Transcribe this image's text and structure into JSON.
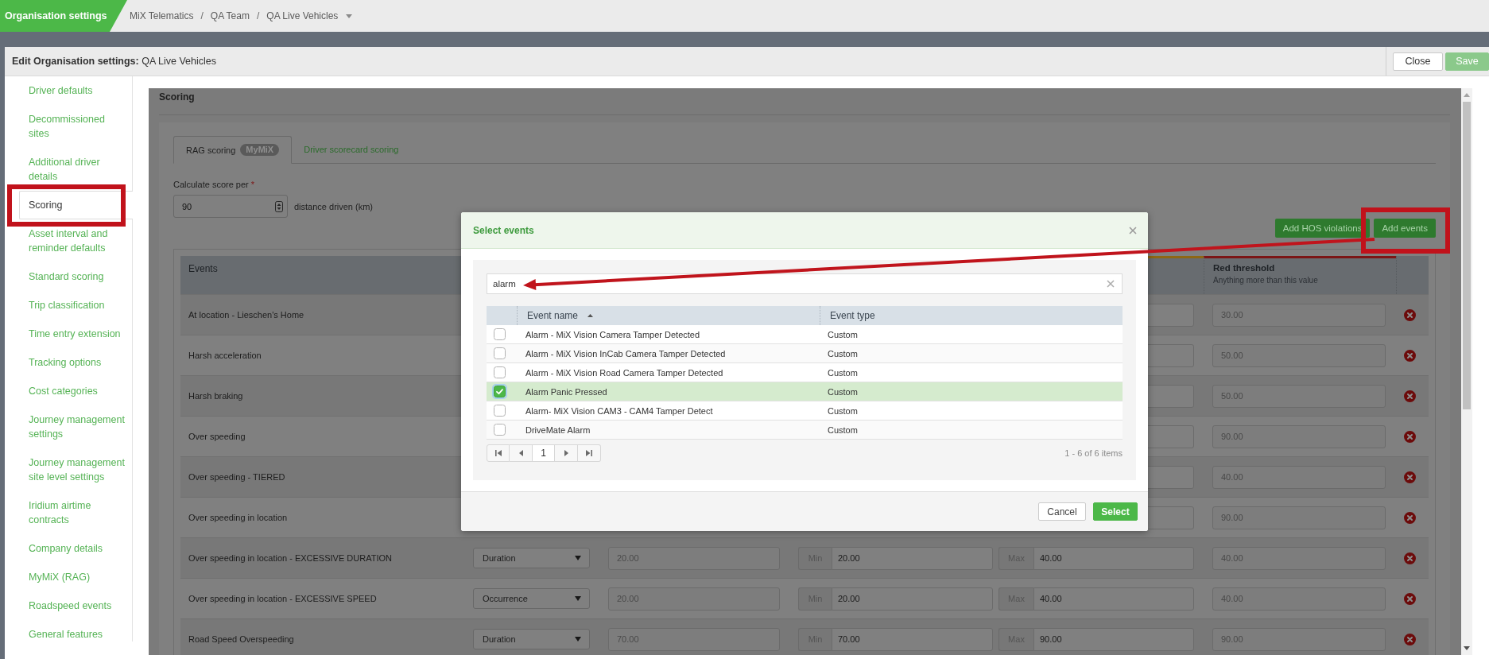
{
  "top_bar": {
    "title": "Organisation settings",
    "separator": "/",
    "breadcrumb": [
      {
        "label": "MiX Telematics",
        "dropdown": false
      },
      {
        "label": "QA Team",
        "dropdown": false
      },
      {
        "label": "QA Live Vehicles",
        "dropdown": true
      }
    ]
  },
  "panel": {
    "title": "**Edit Organisation settings:** QA Live Vehicles",
    "buttons": [
      {
        "label": "Close",
        "kind": "default",
        "disabled": false
      },
      {
        "label": "Save",
        "kind": "primary",
        "disabled": true
      }
    ]
  },
  "sidebar": {
    "items": [
      {
        "label": "Driver defaults",
        "selected": false
      },
      {
        "label": "Decommissioned sites",
        "selected": false
      },
      {
        "label": "Additional driver details",
        "selected": false
      },
      {
        "label": "Scoring",
        "selected": true
      },
      {
        "label": "Asset interval and reminder defaults",
        "selected": false
      },
      {
        "label": "Standard scoring",
        "selected": false
      },
      {
        "label": "Trip classification",
        "selected": false
      },
      {
        "label": "Time entry extension",
        "selected": false
      },
      {
        "label": "Tracking options",
        "selected": false
      },
      {
        "label": "Cost categories",
        "selected": false
      },
      {
        "label": "Journey management settings",
        "selected": false
      },
      {
        "label": "Journey management site level settings",
        "selected": false
      },
      {
        "label": "Iridium airtime contracts",
        "selected": false
      },
      {
        "label": "Company details",
        "selected": false
      },
      {
        "label": "MyMiX (RAG)",
        "selected": false
      },
      {
        "label": "Roadspeed events",
        "selected": false
      },
      {
        "label": "General features",
        "selected": false
      }
    ]
  },
  "section": {
    "title": "Scoring",
    "tabs": [
      {
        "label": "RAG scoring",
        "badge": "MyMiX",
        "selected": true
      },
      {
        "label": "Driver scorecard scoring",
        "selected": false
      }
    ],
    "score_field": {
      "label": "Calculate score per",
      "required_mark": "*",
      "value": "90",
      "unit": "distance driven (km)"
    },
    "actions": [
      {
        "label": "Add HOS violations"
      },
      {
        "label": "Add events"
      }
    ],
    "table": {
      "columns": [
        {
          "kind": "name",
          "label": "Events"
        },
        {
          "kind": "threshold",
          "label": "Red threshold",
          "hint": "Anything more than this value"
        }
      ],
      "rows": [
        {
          "kind": "covered",
          "event": "At location - Lieschen's Home",
          "red_threshold": "30.00"
        },
        {
          "kind": "covered",
          "event": "Harsh acceleration",
          "red_threshold": "50.00"
        },
        {
          "kind": "covered",
          "event": "Harsh braking",
          "red_threshold": "50.00"
        },
        {
          "kind": "covered",
          "event": "Over speeding",
          "red_threshold": "90.00"
        },
        {
          "kind": "covered",
          "event": "Over speeding - TIERED",
          "red_threshold": "40.00"
        },
        {
          "kind": "covered",
          "event": "Over speeding in location",
          "red_threshold": "90.00"
        },
        {
          "kind": "full",
          "event": "Over speeding in location - EXCESSIVE DURATION",
          "measure": "Duration",
          "value": "20.00",
          "min_label": "Min",
          "min": "20.00",
          "max_label": "Max",
          "max": "40.00",
          "red_threshold": "40.00"
        },
        {
          "kind": "full",
          "event": "Over speeding in location - EXCESSIVE SPEED",
          "measure": "Occurrence",
          "value": "20.00",
          "min_label": "Min",
          "min": "20.00",
          "max_label": "Max",
          "max": "40.00",
          "red_threshold": "40.00"
        },
        {
          "kind": "full",
          "event": "Road Speed Overspeeding",
          "measure": "Duration",
          "value": "70.00",
          "min_label": "Min",
          "min": "70.00",
          "max_label": "Max",
          "max": "90.00",
          "red_threshold": "90.00"
        }
      ]
    }
  },
  "dialog": {
    "title": "Select events",
    "search": {
      "value": "alarm"
    },
    "columns": [
      {
        "label": "Event name",
        "sort_ascending": true
      },
      {
        "label": "Event type",
        "sort_ascending": false
      }
    ],
    "rows": [
      {
        "name": "Alarm - MiX Vision Camera Tamper Detected",
        "type": "Custom",
        "checked": false,
        "focused": false,
        "selected": false
      },
      {
        "name": "Alarm - MiX Vision InCab Camera Tamper Detected",
        "type": "Custom",
        "checked": false,
        "focused": false,
        "selected": false
      },
      {
        "name": "Alarm - MiX Vision Road Camera Tamper Detected",
        "type": "Custom",
        "checked": false,
        "focused": false,
        "selected": false
      },
      {
        "name": "Alarm Panic Pressed",
        "type": "Custom",
        "checked": true,
        "focused": true,
        "selected": true
      },
      {
        "name": "Alarm- MiX Vision CAM3 - CAM4 Tamper Detect",
        "type": "Custom",
        "checked": false,
        "focused": false,
        "selected": false
      },
      {
        "name": "DriveMate Alarm",
        "type": "Custom",
        "checked": false,
        "focused": false,
        "selected": false
      }
    ],
    "pager": {
      "page": "1",
      "summary": "1 - 6 of 6 items"
    },
    "buttons": [
      {
        "label": "Cancel",
        "kind": "secondary"
      },
      {
        "label": "Select",
        "kind": "primary"
      }
    ]
  }
}
